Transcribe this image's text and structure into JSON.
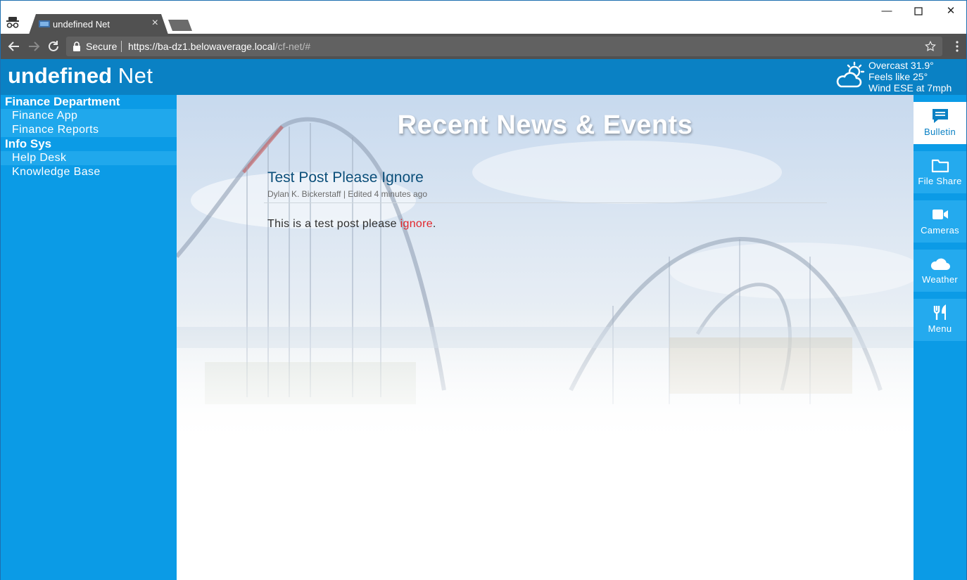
{
  "browser": {
    "tab_title": "undefined Net",
    "tab_close": "×",
    "secure_label": "Secure",
    "url_host": "https://ba-dz1.belowaverage.local",
    "url_path": "/cf-net/#",
    "minimize": "—",
    "close": "✕"
  },
  "header": {
    "brand_bold": "undefined",
    "brand_light": "Net",
    "weather": {
      "icon": "partly-cloudy-icon",
      "line1": "Overcast 31.9°",
      "line2": "Feels like 25°",
      "line3": "Wind ESE at 7mph"
    }
  },
  "sidebar": {
    "groups": [
      {
        "heading": "Finance Department",
        "items": [
          "Finance App",
          "Finance Reports"
        ]
      },
      {
        "heading": "Info Sys",
        "items": [
          "Help Desk",
          "Knowledge Base"
        ]
      }
    ]
  },
  "main": {
    "title": "Recent News & Events",
    "post": {
      "title": "Test Post Please Ignore",
      "meta": "Dylan K. Bickerstaff | Edited 4 minutes ago",
      "body_before": "This is a test post please ",
      "body_highlight": "ignore",
      "body_after": "."
    }
  },
  "rail": {
    "items": [
      {
        "label": "Bulletin",
        "icon": "comment-icon",
        "active": true
      },
      {
        "label": "File Share",
        "icon": "folder-icon",
        "active": false
      },
      {
        "label": "Cameras",
        "icon": "video-camera-icon",
        "active": false
      },
      {
        "label": "Weather",
        "icon": "cloud-icon",
        "active": false
      },
      {
        "label": "Menu",
        "icon": "fork-knife-icon",
        "active": false
      }
    ]
  },
  "colors": {
    "header_blue": "#0a81c4",
    "sidebar_blue": "#0b9be6",
    "post_title": "#0b4f7a",
    "highlight_red": "#e2252b"
  }
}
